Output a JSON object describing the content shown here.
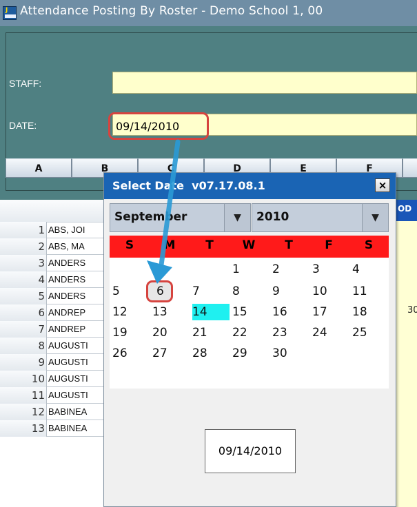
{
  "window": {
    "title": "Attendance Posting By Roster - Demo School 1, 00"
  },
  "form": {
    "staff_label": "STAFF:",
    "date_label": "DATE:",
    "date_value": "09/14/2010"
  },
  "tabs": [
    "A",
    "B",
    "C",
    "D",
    "E",
    "F"
  ],
  "grid": {
    "right_header": "OD",
    "right_cell_value": "30",
    "rows": [
      {
        "num": "1",
        "name": "ABS, JOI"
      },
      {
        "num": "2",
        "name": "ABS, MA"
      },
      {
        "num": "3",
        "name": "ANDERS"
      },
      {
        "num": "4",
        "name": "ANDERS"
      },
      {
        "num": "5",
        "name": "ANDERS"
      },
      {
        "num": "6",
        "name": "ANDREP"
      },
      {
        "num": "7",
        "name": "ANDREP"
      },
      {
        "num": "8",
        "name": "AUGUSTI"
      },
      {
        "num": "9",
        "name": "AUGUSTI"
      },
      {
        "num": "10",
        "name": "AUGUSTI"
      },
      {
        "num": "11",
        "name": "AUGUSTI"
      },
      {
        "num": "12",
        "name": "BABINEA"
      },
      {
        "num": "13",
        "name": "BABINEA"
      }
    ]
  },
  "dialog": {
    "title": "Select Date",
    "version": "v07.17.08.1",
    "close_glyph": "×",
    "month": "September",
    "year": "2010",
    "day_headers": [
      "S",
      "M",
      "T",
      "W",
      "T",
      "F",
      "S"
    ],
    "weeks": [
      [
        "",
        "",
        "",
        "1",
        "2",
        "3",
        "4"
      ],
      [
        "5",
        "6",
        "7",
        "8",
        "9",
        "10",
        "11"
      ],
      [
        "12",
        "13",
        "14",
        "15",
        "16",
        "17",
        "18"
      ],
      [
        "19",
        "20",
        "21",
        "22",
        "23",
        "24",
        "25"
      ],
      [
        "26",
        "27",
        "28",
        "29",
        "30",
        "",
        ""
      ]
    ],
    "selected_day": "14",
    "highlighted_day": "6",
    "date_value": "09/14/2010"
  },
  "colors": {
    "title_bar": "#6f8ea5",
    "panel": "#4f8082",
    "field_bg": "#ffffcc",
    "dialog_title": "#1a64b4",
    "day_header": "#ff1a1a",
    "today": "#1ff0f0",
    "highlight": "#d6443f",
    "arrow": "#2a9ad6"
  },
  "icons": [
    "app-icon",
    "chevron-down-icon",
    "close-icon",
    "arrow-annotation"
  ]
}
